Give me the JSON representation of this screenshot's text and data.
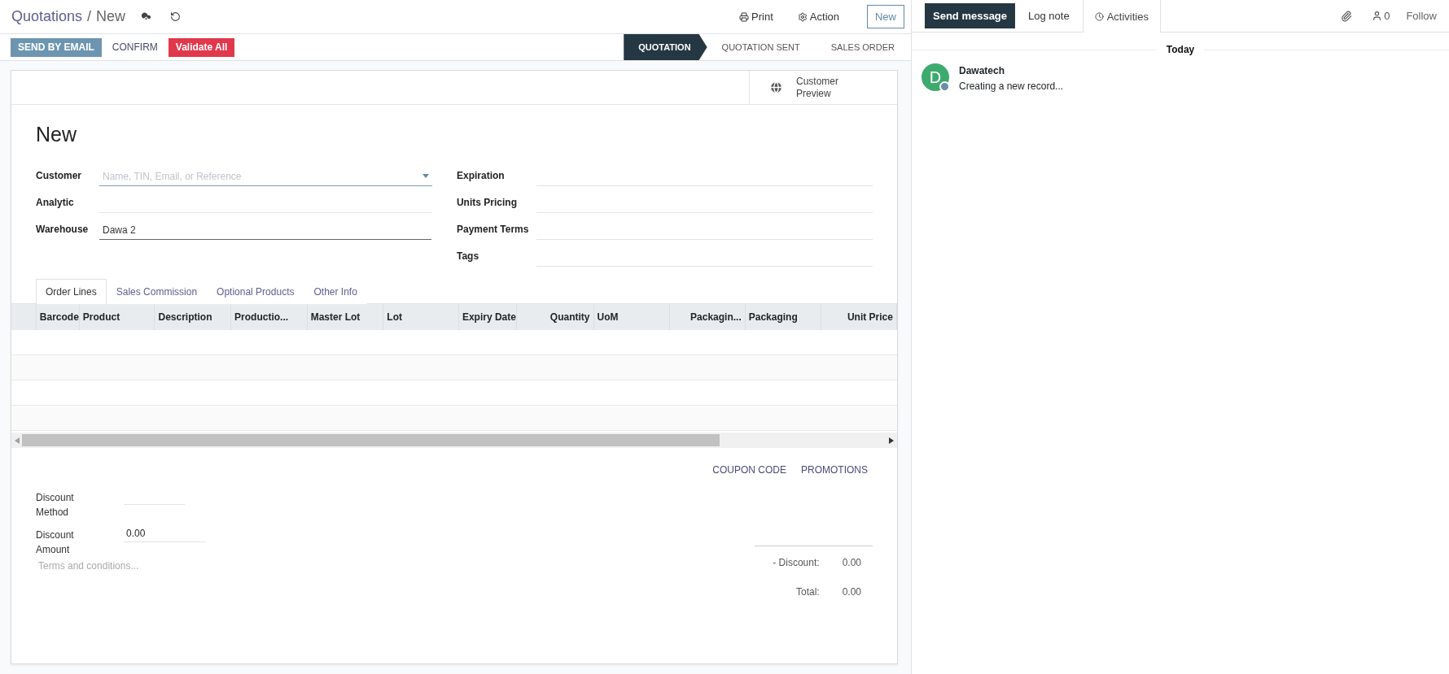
{
  "breadcrumb": {
    "parent": "Quotations",
    "separator": "/",
    "current": "New"
  },
  "toolbar": {
    "print": "Print",
    "action": "Action",
    "new_button": "New"
  },
  "buttons": [
    {
      "label": "SEND BY EMAIL",
      "kind": "primary"
    },
    {
      "label": "CONFIRM",
      "kind": "plain"
    },
    {
      "label": "Validate All",
      "kind": "danger"
    }
  ],
  "stages": [
    {
      "label": "QUOTATION",
      "selected": true
    },
    {
      "label": "QUOTATION SENT",
      "selected": false
    },
    {
      "label": "SALES ORDER",
      "selected": false
    }
  ],
  "smart_button": {
    "label": "Customer Preview"
  },
  "title": "New",
  "fields_left": [
    {
      "label": "Customer",
      "placeholder": "Name, TIN, Email, or Reference",
      "kind": "select"
    },
    {
      "label": "Analytic",
      "kind": "text"
    },
    {
      "label": "Warehouse",
      "value": "Dawa 2",
      "kind": "filled"
    }
  ],
  "fields_right": [
    {
      "label": "Expiration"
    },
    {
      "label": "Units Pricing"
    },
    {
      "label": "Payment Terms"
    },
    {
      "label": "Tags"
    }
  ],
  "tabs": [
    {
      "label": "Order Lines",
      "selected": true
    },
    {
      "label": "Sales Commission",
      "selected": false
    },
    {
      "label": "Optional Products",
      "selected": false
    },
    {
      "label": "Other Info",
      "selected": false
    }
  ],
  "table": {
    "columns": [
      {
        "label": "Barcode",
        "kind": "text"
      },
      {
        "label": "Product",
        "kind": "text"
      },
      {
        "label": "Description",
        "kind": "text"
      },
      {
        "label": "Productio...",
        "kind": "text"
      },
      {
        "label": "Master Lot",
        "kind": "text"
      },
      {
        "label": "Lot",
        "kind": "text"
      },
      {
        "label": "Expiry Date",
        "kind": "text"
      },
      {
        "label": "Quantity",
        "kind": "number"
      },
      {
        "label": "UoM",
        "kind": "text"
      },
      {
        "label": "Packagin...",
        "kind": "number"
      },
      {
        "label": "Packaging",
        "kind": "text"
      },
      {
        "label": "Unit Price",
        "kind": "number"
      }
    ]
  },
  "promo_buttons": [
    "COUPON CODE",
    "PROMOTIONS"
  ],
  "discount_fields": [
    {
      "label": "Discount Method"
    },
    {
      "label": "Discount Amount",
      "value": "0.00"
    }
  ],
  "terms": {
    "placeholder": "Terms and conditions..."
  },
  "totals": [
    {
      "label": "- Discount:",
      "value": "0.00"
    },
    {
      "label": "Total:",
      "value": "0.00"
    }
  ],
  "chatter": {
    "actions": [
      {
        "label": "Send message",
        "kind": "primary"
      },
      {
        "label": "Log note",
        "kind": "tab"
      },
      {
        "label": "Activities",
        "kind": "activities"
      }
    ],
    "followers_count": "0",
    "follow": "Follow",
    "day": "Today",
    "messages": [
      {
        "author": "Dawatech",
        "initial": "D",
        "text": "Creating a new record..."
      }
    ]
  }
}
